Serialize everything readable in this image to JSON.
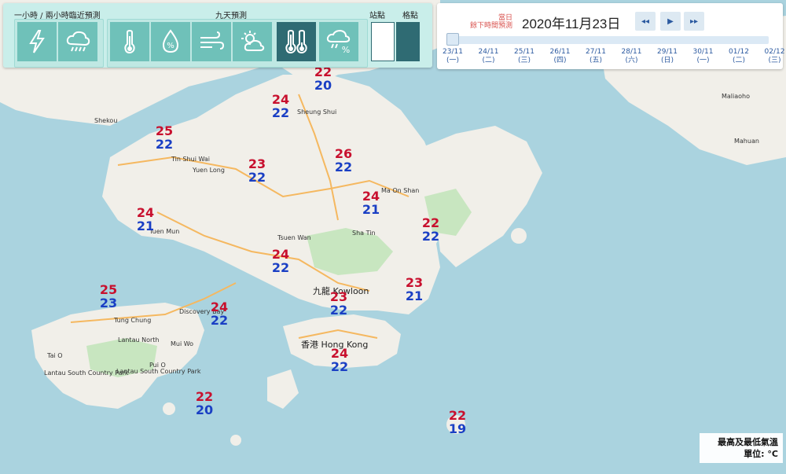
{
  "toolbar": {
    "group1_label": "一小時 / 兩小時臨近預測",
    "group2_label": "九天預測",
    "station_label": "站點",
    "grid_label": "格點",
    "buttons": [
      {
        "icon": "lightning-icon",
        "active": false
      },
      {
        "icon": "rain-cloud-icon",
        "active": false
      },
      {
        "icon": "thermometer-icon",
        "active": false
      },
      {
        "icon": "humidity-drop-icon",
        "active": false
      },
      {
        "icon": "wind-icon",
        "active": false
      },
      {
        "icon": "sun-cloud-icon",
        "active": false
      },
      {
        "icon": "max-min-temperature-icon",
        "active": true
      },
      {
        "icon": "rain-probability-icon",
        "active": false
      }
    ]
  },
  "datebar": {
    "day_label_1": "當日",
    "day_label_2": "餘下時間預測",
    "date": "2020年11月23日",
    "nav_prev": "◂◂",
    "nav_play": "▶",
    "nav_next": "▸▸",
    "ticks": [
      {
        "date": "23/11",
        "weekday": "(一)"
      },
      {
        "date": "24/11",
        "weekday": "(二)"
      },
      {
        "date": "25/11",
        "weekday": "(三)"
      },
      {
        "date": "26/11",
        "weekday": "(四)"
      },
      {
        "date": "27/11",
        "weekday": "(五)"
      },
      {
        "date": "28/11",
        "weekday": "(六)"
      },
      {
        "date": "29/11",
        "weekday": "(日)"
      },
      {
        "date": "30/11",
        "weekday": "(一)"
      },
      {
        "date": "01/12",
        "weekday": "(二)"
      },
      {
        "date": "02/12",
        "weekday": "(三)"
      }
    ],
    "selected_index": 0
  },
  "temps": [
    {
      "hi": "22",
      "lo": "20"
    },
    {
      "hi": "24",
      "lo": "22"
    },
    {
      "hi": "25",
      "lo": "22"
    },
    {
      "hi": "26",
      "lo": "22"
    },
    {
      "hi": "23",
      "lo": "22"
    },
    {
      "hi": "24",
      "lo": "21"
    },
    {
      "hi": "22",
      "lo": "22"
    },
    {
      "hi": "24",
      "lo": "21"
    },
    {
      "hi": "24",
      "lo": "22"
    },
    {
      "hi": "25",
      "lo": "23"
    },
    {
      "hi": "24",
      "lo": "22"
    },
    {
      "hi": "23",
      "lo": "22"
    },
    {
      "hi": "23",
      "lo": "21"
    },
    {
      "hi": "24",
      "lo": "22"
    },
    {
      "hi": "22",
      "lo": "20"
    },
    {
      "hi": "22",
      "lo": "19"
    }
  ],
  "places": {
    "shekou": "Shekou",
    "tin_shui_wai": "Tin Shui Wai",
    "yuen_long": "Yuen Long",
    "tuen_mun": "Tuen Mun",
    "sheung_shui": "Sheung Shui",
    "ma_on_shan": "Ma On Shan",
    "sha_tin": "Sha Tin",
    "tsuen_wan": "Tsuen Wan",
    "kowloon": "九龍 Kowloon",
    "hong_kong": "香港 Hong Kong",
    "tung_chung": "Tung Chung",
    "discovery_bay": "Discovery Bay",
    "mui_wo": "Mui Wo",
    "tai_o": "Tai O",
    "lantau_north": "Lantau North",
    "lantau_south": "Lantau South Country Park",
    "pui_o": "Pui O",
    "lantau_south_2": "Lantau South Country Park",
    "maliaoho": "Maliaoho",
    "mahuan": "Mahuan"
  },
  "legend": {
    "line1": "最高及最低氣溫",
    "line2": "單位: °C"
  },
  "colors": {
    "sea": "#aad3df",
    "land": "#f1efe9",
    "park": "#c8e6c0",
    "toolbar_bg": "#c9eeea",
    "button": "#6fc1b9",
    "button_active": "#2f6b73",
    "max_temp": "#c8102e",
    "min_temp": "#1a3fc4"
  }
}
